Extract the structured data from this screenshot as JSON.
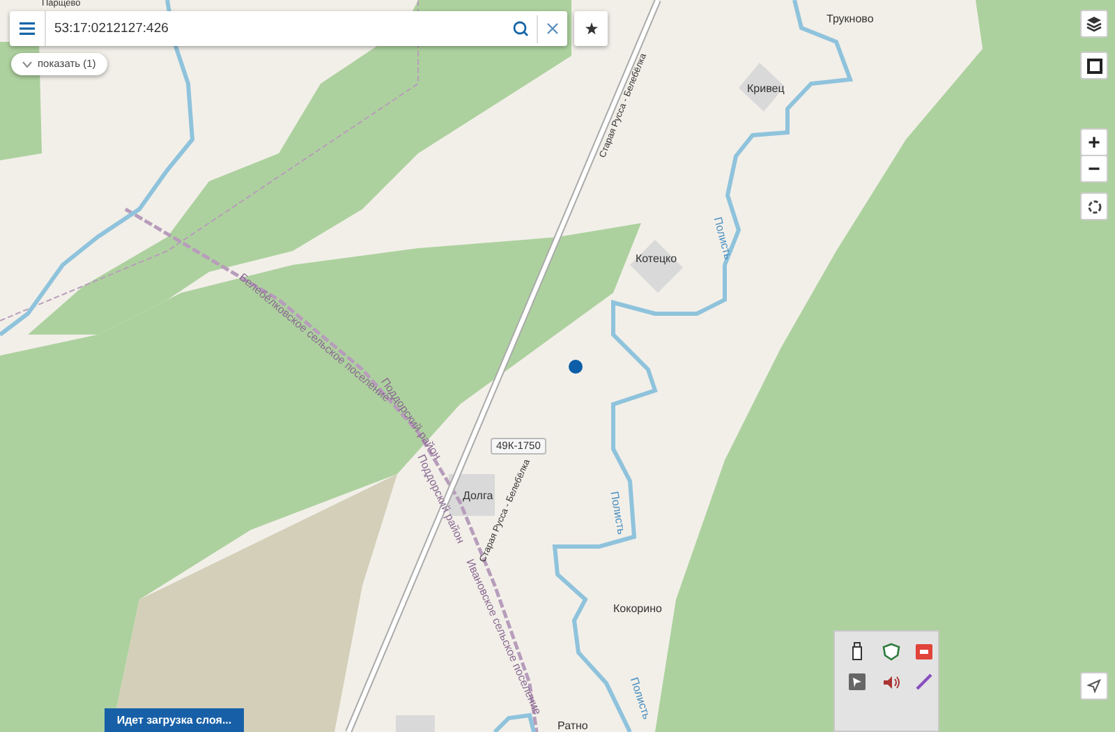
{
  "search": {
    "value": "53:17:0212127:426"
  },
  "show_results": {
    "label": "показать (1)"
  },
  "map": {
    "places": [
      "Парщево",
      "Трукново",
      "Кривец",
      "Котецко",
      "Долга",
      "Кокорино",
      "Ратно"
    ],
    "road_number": "49К-1750",
    "road_names": [
      "Старая Русса - Белебёлка",
      "Старая Русса - Белебёлка"
    ],
    "river_names": [
      "Полисть",
      "Полисть",
      "Полисть"
    ],
    "boundary_names": [
      "Белебёлковское сельское поселение",
      "Поддорский район",
      "Поддорский район",
      "Ивановское сельское поселение"
    ]
  },
  "zoom": {
    "in": "+",
    "out": "−"
  },
  "loading_message": "Идет загрузка слоя...",
  "tray_icons": [
    {
      "kind": "drive"
    },
    {
      "kind": "shield"
    },
    {
      "kind": "app"
    },
    {
      "kind": "app-grey"
    },
    {
      "kind": "speaker"
    },
    {
      "kind": "pen"
    }
  ]
}
